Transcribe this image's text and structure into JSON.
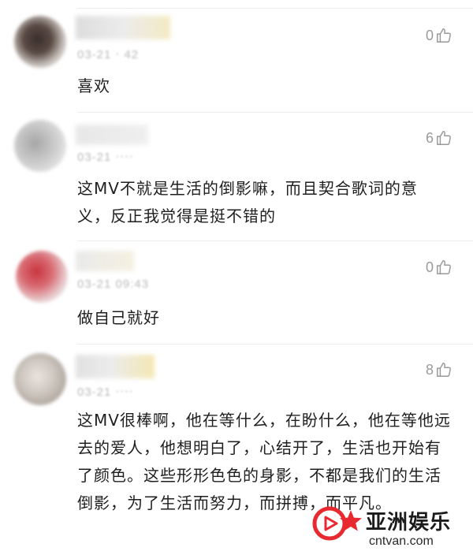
{
  "comments": [
    {
      "likes": "0",
      "text": "喜欢"
    },
    {
      "likes": "6",
      "text": "这MV不就是生活的倒影嘛，而且契合歌词的意义，反正我觉得是挺不错的"
    },
    {
      "likes": "0",
      "text": "做自己就好"
    },
    {
      "likes": "8",
      "text": "这MV很棒啊，他在等什么，在盼什么，他在等他远去的爱人，他想明白了，心结开了，生活也开始有了颜色。这些形形色色的身影，不都是我们的生活倒影，为了生活而努力，而拼搏，而平凡。"
    }
  ],
  "watermark": {
    "title": "亚洲娱乐",
    "url": "cntvan.com"
  },
  "colors": {
    "like_gray": "#9a9a9a",
    "watermark_red": "#e8292f"
  }
}
